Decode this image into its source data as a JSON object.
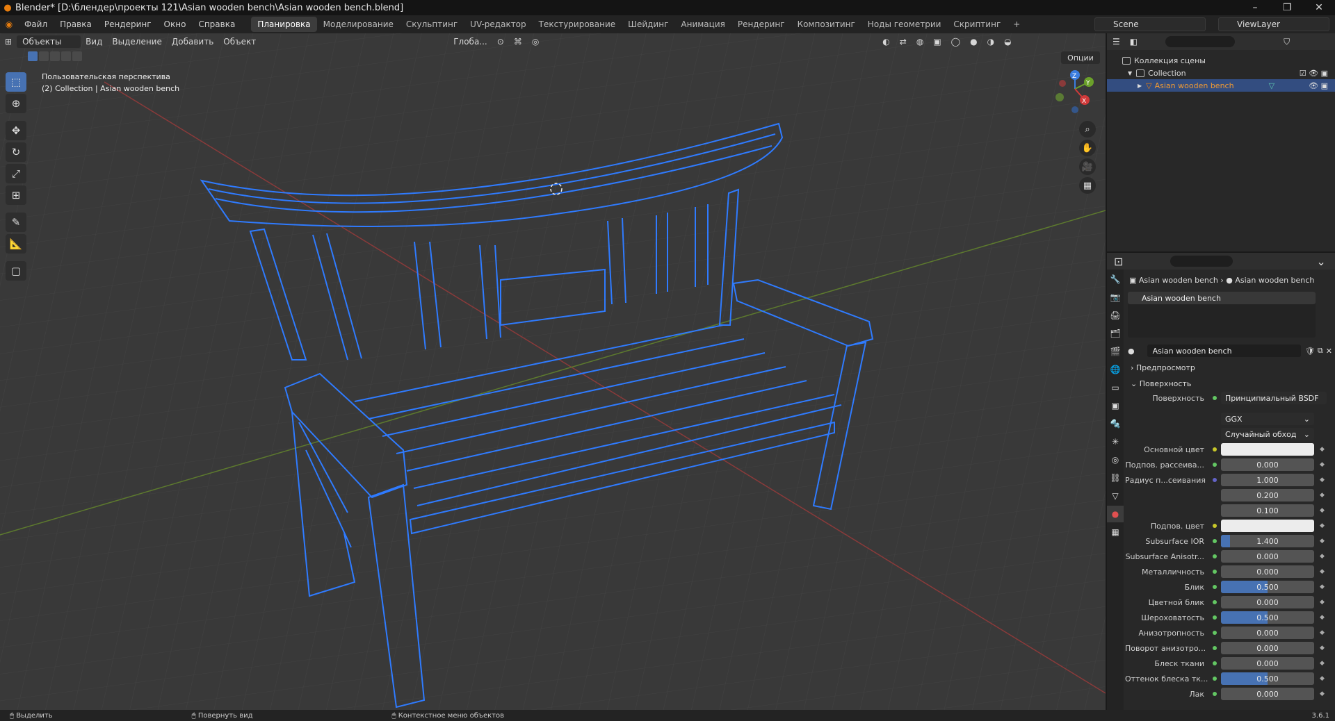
{
  "window": {
    "title": "Blender* [D:\\блендер\\проекты 121\\Asian wooden bench\\Asian wooden bench.blend]",
    "minimize": "–",
    "maximize": "❐",
    "close": "✕"
  },
  "menu": [
    "Файл",
    "Правка",
    "Рендеринг",
    "Окно",
    "Справка"
  ],
  "workspaces": [
    "Планировка",
    "Моделирование",
    "Скульптинг",
    "UV-редактор",
    "Текстурирование",
    "Шейдинг",
    "Анимация",
    "Рендеринг",
    "Композитинг",
    "Ноды геометрии",
    "Скриптинг",
    "+"
  ],
  "scene_name": "Scene",
  "view_layer": "ViewLayer",
  "viewport": {
    "mode": "Объекты",
    "menus": [
      "Вид",
      "Выделение",
      "Добавить",
      "Объект"
    ],
    "orientation": "Глоба...",
    "options": "Опции",
    "info_line1": "Пользовательская перспектива",
    "info_line2": "(2) Collection | Asian wooden bench",
    "gizmo": {
      "z": "Z",
      "y": "Y",
      "x": "X"
    }
  },
  "outliner": {
    "root": "Коллекция сцены",
    "collection": "Collection",
    "object": "Asian wooden bench"
  },
  "properties": {
    "breadcrumb_object": "Asian wooden bench",
    "breadcrumb_material": "Asian wooden bench",
    "slot": "Asian wooden bench",
    "material_name": "Asian wooden bench",
    "panel_preview": "Предпросмотр",
    "panel_surface": "Поверхность",
    "surface_label": "Поверхность",
    "surface_value": "Принципиальный BSDF",
    "distribution": "GGX",
    "subsurface_method": "Случайный обход",
    "rows": [
      {
        "label": "Основной цвет",
        "value": "",
        "kind": "color",
        "dot": "y"
      },
      {
        "label": "Подпов. рассеива...",
        "value": "0.000",
        "kind": "num",
        "fill": 0,
        "dot": "g"
      },
      {
        "label": "Радиус п...сеивания",
        "value": "1.000",
        "kind": "num",
        "fill": 0,
        "dot": "p"
      },
      {
        "label": "",
        "value": "0.200",
        "kind": "num",
        "fill": 0,
        "dot": ""
      },
      {
        "label": "",
        "value": "0.100",
        "kind": "num",
        "fill": 0,
        "dot": ""
      },
      {
        "label": "Подпов. цвет",
        "value": "",
        "kind": "color",
        "dot": "y"
      },
      {
        "label": "Subsurface IOR",
        "value": "1.400",
        "kind": "num",
        "fill": 0.1,
        "dot": "g"
      },
      {
        "label": "Subsurface Anisotr...",
        "value": "0.000",
        "kind": "num",
        "fill": 0,
        "dot": "g"
      },
      {
        "label": "Металличность",
        "value": "0.000",
        "kind": "num",
        "fill": 0,
        "dot": "g"
      },
      {
        "label": "Блик",
        "value": "0.500",
        "kind": "num",
        "fill": 0.5,
        "dot": "g"
      },
      {
        "label": "Цветной блик",
        "value": "0.000",
        "kind": "num",
        "fill": 0,
        "dot": "g"
      },
      {
        "label": "Шероховатость",
        "value": "0.500",
        "kind": "num",
        "fill": 0.5,
        "dot": "g"
      },
      {
        "label": "Анизотропность",
        "value": "0.000",
        "kind": "num",
        "fill": 0,
        "dot": "g"
      },
      {
        "label": "Поворот анизотро...",
        "value": "0.000",
        "kind": "num",
        "fill": 0,
        "dot": "g"
      },
      {
        "label": "Блеск ткани",
        "value": "0.000",
        "kind": "num",
        "fill": 0,
        "dot": "g"
      },
      {
        "label": "Оттенок блеска тк...",
        "value": "0.500",
        "kind": "num",
        "fill": 0.5,
        "dot": "g"
      },
      {
        "label": "Лак",
        "value": "0.000",
        "kind": "num",
        "fill": 0,
        "dot": "g"
      }
    ]
  },
  "status": {
    "select": "Выделить",
    "rotate": "Повернуть вид",
    "context": "Контекстное меню объектов",
    "version": "3.6.1"
  },
  "colors": {
    "wire": "#2f7bff",
    "accent": "#4772b3",
    "bg": "#393939"
  }
}
